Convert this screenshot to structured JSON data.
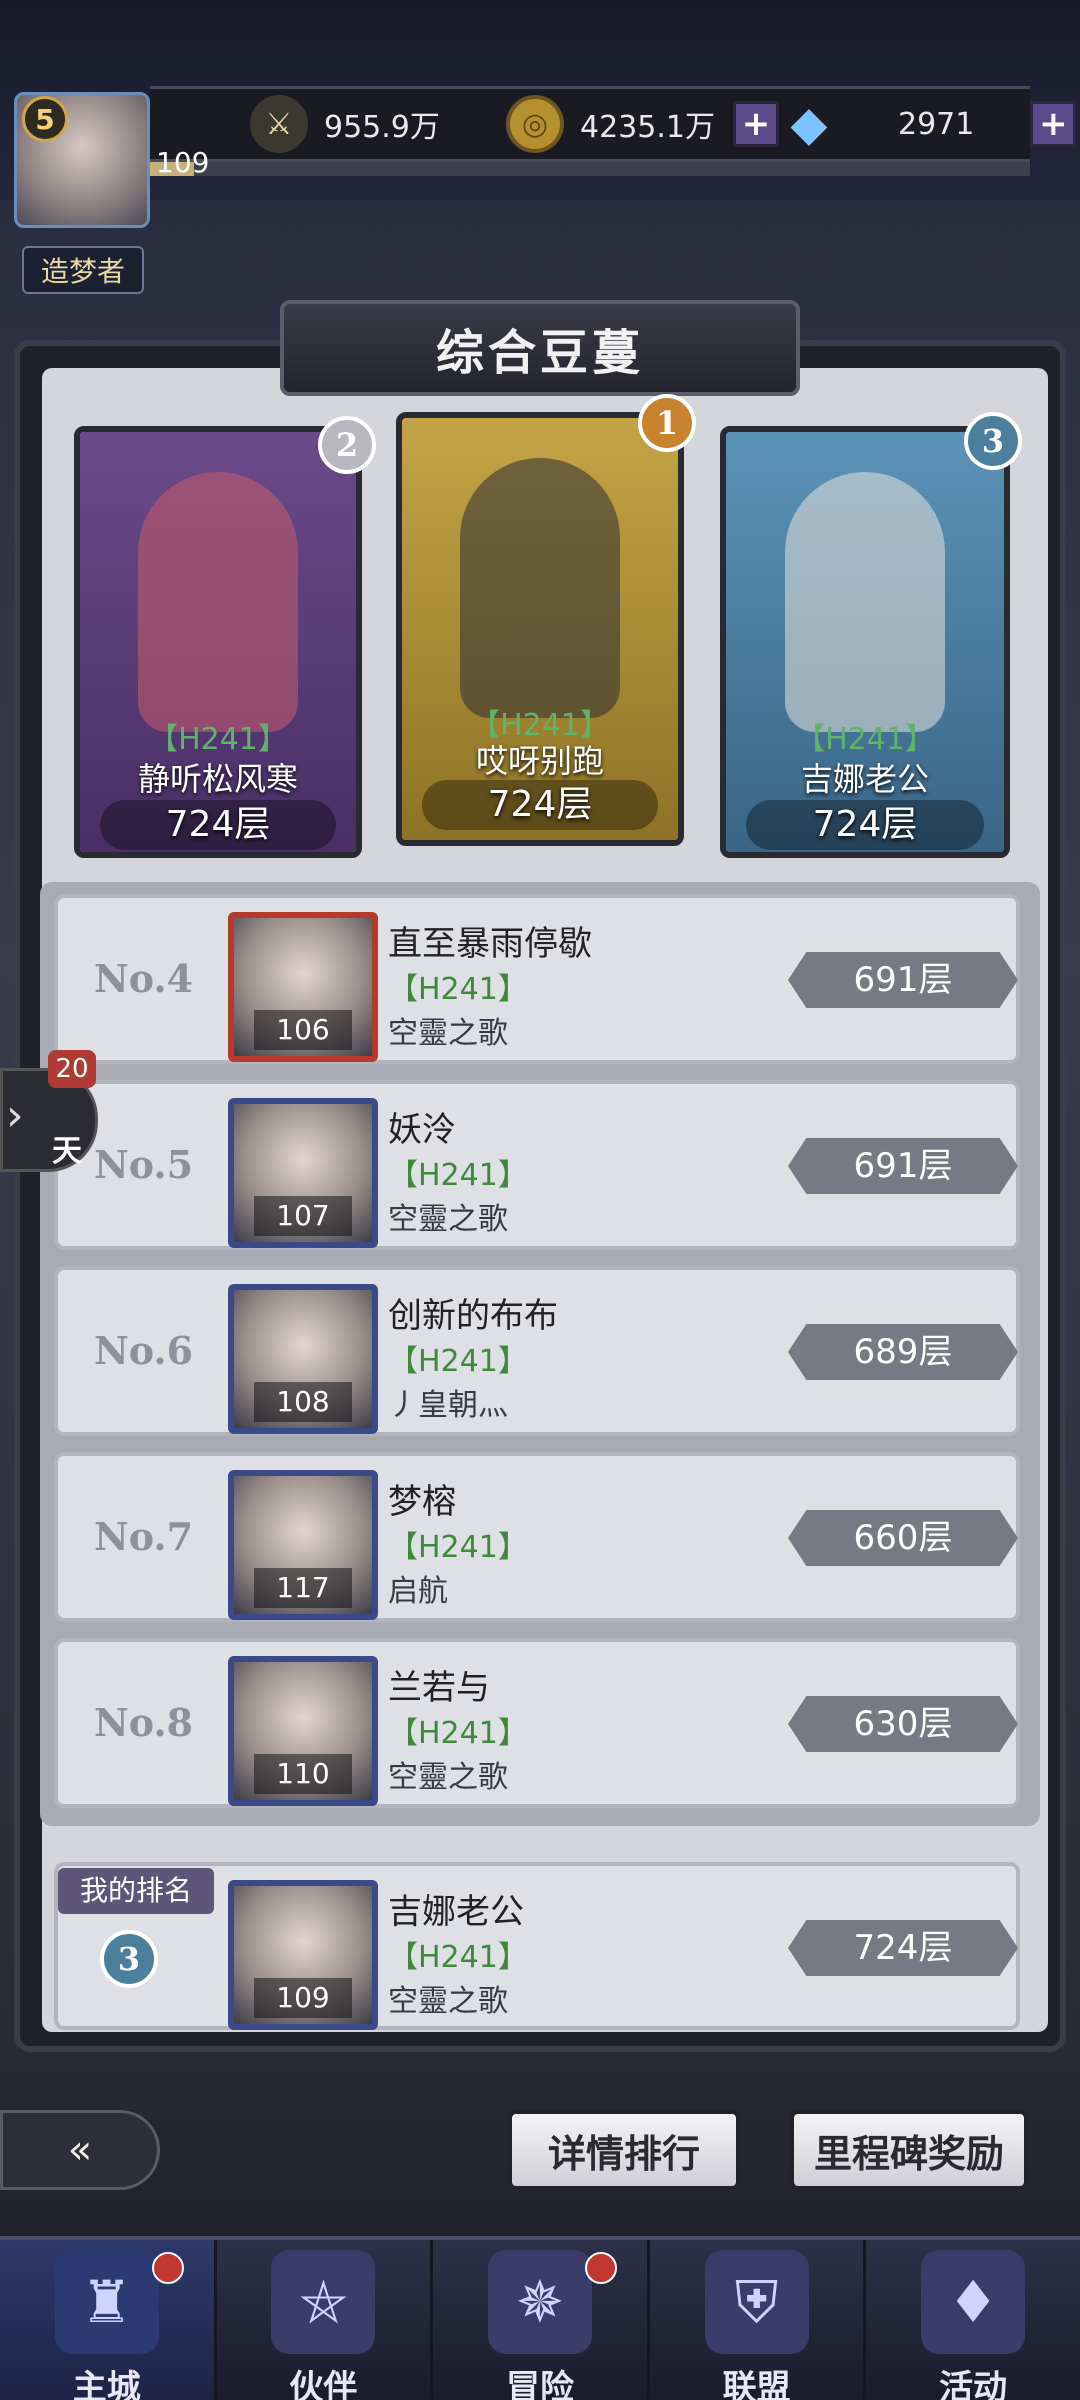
{
  "player": {
    "level": "5",
    "exp_level": "109",
    "exp_fraction": 0.05,
    "title": "造梦者",
    "avatar_icon": "player-portrait-icon"
  },
  "resources": {
    "power": {
      "icon": "sword-icon",
      "value": "955.9万"
    },
    "gold": {
      "icon": "gold-coin-icon",
      "value": "4235.1万",
      "has_plus": true
    },
    "diamond": {
      "icon": "diamond-icon",
      "value": "2971",
      "has_plus": true
    },
    "plus_symbol": "+"
  },
  "panel": {
    "title": "综合豆蔓"
  },
  "top3": [
    {
      "medal": "2",
      "tag": "【H241】",
      "name": "静听松风寒",
      "floor": "724层",
      "medal_color": "#b7b7bf",
      "bg": "#6b4a8a"
    },
    {
      "medal": "1",
      "tag": "【H241】",
      "name": "哎呀别跑",
      "floor": "724层",
      "medal_color": "#c9822d",
      "bg": "#b89a3a"
    },
    {
      "medal": "3",
      "tag": "【H241】",
      "name": "吉娜老公",
      "floor": "724层",
      "medal_color": "#4c7f9c",
      "bg": "#4d83a8"
    }
  ],
  "ranks": [
    {
      "rank": "No.4",
      "name": "直至暴雨停歇",
      "tag": "【H241】",
      "guild": "空靈之歌",
      "level": "106",
      "floor": "691层"
    },
    {
      "rank": "No.5",
      "name": "妖泠",
      "tag": "【H241】",
      "guild": "空靈之歌",
      "level": "107",
      "floor": "691层"
    },
    {
      "rank": "No.6",
      "name": "创新的布布",
      "tag": "【H241】",
      "guild": "丿皇朝灬",
      "level": "108",
      "floor": "689层"
    },
    {
      "rank": "No.7",
      "name": "梦榕",
      "tag": "【H241】",
      "guild": "启航",
      "level": "117",
      "floor": "660层"
    },
    {
      "rank": "No.8",
      "name": "兰若与",
      "tag": "【H241】",
      "guild": "空靈之歌",
      "level": "110",
      "floor": "630层"
    }
  ],
  "my_rank": {
    "label": "我的排名",
    "medal": "3",
    "name": "吉娜老公",
    "tag": "【H241】",
    "guild": "空靈之歌",
    "level": "109",
    "floor": "724层"
  },
  "side_timer": {
    "count": "20",
    "label": "天"
  },
  "buttons": {
    "back_icon": "back-arrow-icon",
    "back_glyph": "«",
    "detail": "详情排行",
    "milestone": "里程碑奖励"
  },
  "nav": [
    {
      "label": "主城",
      "icon": "castle-icon",
      "glyph": "♜",
      "active": true,
      "badge": true
    },
    {
      "label": "伙伴",
      "icon": "witch-hat-icon",
      "glyph": "⛤",
      "active": false,
      "badge": false
    },
    {
      "label": "冒险",
      "icon": "compass-icon",
      "glyph": "✵",
      "active": false,
      "badge": true
    },
    {
      "label": "联盟",
      "icon": "shield-icon",
      "glyph": "⛨",
      "active": false,
      "badge": false
    },
    {
      "label": "活动",
      "icon": "cards-icon",
      "glyph": "♦",
      "active": false,
      "badge": false
    }
  ]
}
